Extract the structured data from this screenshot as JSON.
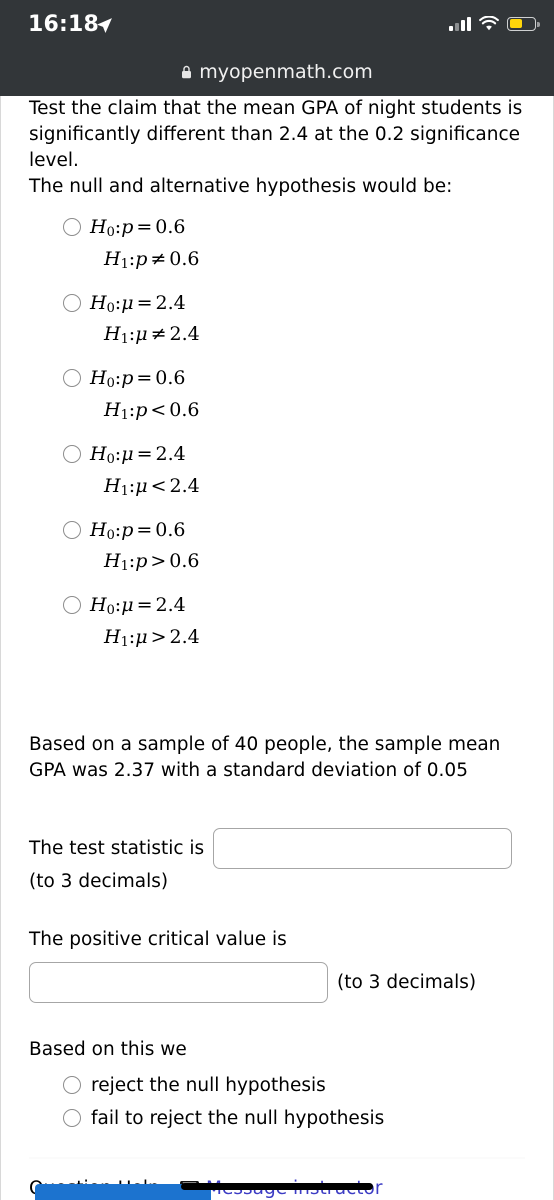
{
  "status_bar": {
    "time": "16:18",
    "location_icon": "location-arrow-icon",
    "signal_icon": "cellular-signal-icon",
    "wifi_icon": "wifi-icon",
    "battery_icon": "battery-icon",
    "battery_color": "#ffd60a"
  },
  "browser": {
    "lock_icon": "lock-icon",
    "url": "myopenmath.com"
  },
  "question": {
    "prompt": "Test the claim that the mean GPA of night students is significantly different than 2.4 at the 0.2 significance level.",
    "hypothesis_intro": "The null and alternative hypothesis would be:",
    "options": [
      {
        "null_symbol": "H",
        "null_sub": "0",
        "null_param": "p",
        "null_op": "=",
        "null_value": "0.6",
        "alt_symbol": "H",
        "alt_sub": "1",
        "alt_param": "p",
        "alt_op": "≠",
        "alt_value": "0.6"
      },
      {
        "null_symbol": "H",
        "null_sub": "0",
        "null_param": "μ",
        "null_op": "=",
        "null_value": "2.4",
        "alt_symbol": "H",
        "alt_sub": "1",
        "alt_param": "μ",
        "alt_op": "≠",
        "alt_value": "2.4"
      },
      {
        "null_symbol": "H",
        "null_sub": "0",
        "null_param": "p",
        "null_op": "=",
        "null_value": "0.6",
        "alt_symbol": "H",
        "alt_sub": "1",
        "alt_param": "p",
        "alt_op": "<",
        "alt_value": "0.6"
      },
      {
        "null_symbol": "H",
        "null_sub": "0",
        "null_param": "μ",
        "null_op": "=",
        "null_value": "2.4",
        "alt_symbol": "H",
        "alt_sub": "1",
        "alt_param": "μ",
        "alt_op": "<",
        "alt_value": "2.4"
      },
      {
        "null_symbol": "H",
        "null_sub": "0",
        "null_param": "p",
        "null_op": "=",
        "null_value": "0.6",
        "alt_symbol": "H",
        "alt_sub": "1",
        "alt_param": "p",
        "alt_op": ">",
        "alt_value": "0.6"
      },
      {
        "null_symbol": "H",
        "null_sub": "0",
        "null_param": "μ",
        "null_op": "=",
        "null_value": "2.4",
        "alt_symbol": "H",
        "alt_sub": "1",
        "alt_param": "μ",
        "alt_op": ">",
        "alt_value": "2.4"
      }
    ],
    "sample_statement": "Based on a sample of 40 people, the sample mean GPA was 2.37 with a standard deviation of 0.05",
    "test_statistic_label": "The test statistic is",
    "test_statistic_value": "",
    "test_statistic_note": "(to 3 decimals)",
    "critical_value_label": "The positive critical value is",
    "critical_value_value": "",
    "critical_value_note": "(to 3 decimals)",
    "conclusion_label": "Based on this we",
    "conclusion_options": [
      "reject the null hypothesis",
      "fail to reject the null hypothesis"
    ]
  },
  "footer": {
    "help_label": "Question Help:",
    "message_icon": "envelope-icon",
    "message_link": "Message instructor",
    "link_color": "#3c3cc4",
    "submit_button_color": "#1c73cf"
  }
}
